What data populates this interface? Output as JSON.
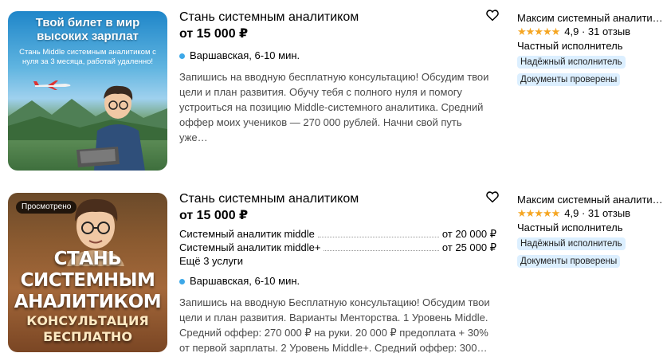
{
  "listings": [
    {
      "image": {
        "headline": "Твой билет в мир высоких зарплат",
        "subtext": "Стань Middle системным аналитиком с нуля за 3 месяца, работай удаленно!"
      },
      "title": "Стань системным аналитиком",
      "price": "от 15 000 ₽",
      "metro": "Варшавская, 6-10 мин.",
      "description": "Запишись на вводную бесплатную консультацию! Обсудим твои цели и план развития. Обучу тебя с полного нуля и помогу устроиться на позицию Middle-системного аналитика. Средний оффер моих учеников — 270 000 рублей. Начни свой путь уже…",
      "seller": "Максим системный аналити…",
      "rating": "4,9 · 31 отзыв",
      "seller_type": "Частный исполнитель",
      "badges": [
        "Надёжный исполнитель",
        "Документы проверены"
      ],
      "metro_color": "#3da8e8",
      "star_color": "#f5a623"
    },
    {
      "viewed_label": "Просмотрено",
      "image": {
        "line1": "СТАНЬ",
        "line2": "СИСТЕМНЫМ",
        "line3": "АНАЛИТИКОМ",
        "line4": "КОНСУЛЬТАЦИЯ",
        "line5": "БЕСПЛАТНО"
      },
      "title": "Стань системным аналитиком",
      "price": "от 15 000 ₽",
      "services": [
        {
          "name": "Системный аналитик middle",
          "price": "от 20 000 ₽"
        },
        {
          "name": "Системный аналитик middle+",
          "price": "от 25 000 ₽"
        }
      ],
      "more_services": "Ещё 3 услуги",
      "metro": "Варшавская, 6-10 мин.",
      "description": "Запишись на вводную Бесплатную консультацию! Обсудим твои цели и план развития. Варианты Менторства. 1 Уровень Middle. Средний оффер: 270 000 ₽ на руки. 20 000 ₽ предоплата + 30% от первой зарплаты. 2 Уровень Middle+. Средний оффер: 300…",
      "seller": "Максим системный аналити…",
      "rating": "4,9 · 31 отзыв",
      "seller_type": "Частный исполнитель",
      "badges": [
        "Надёжный исполнитель",
        "Документы проверены"
      ]
    }
  ],
  "icons": {
    "favorite": "heart-outline-icon",
    "stars": "five-star-rating-icon",
    "metro": "metro-dot-icon"
  }
}
